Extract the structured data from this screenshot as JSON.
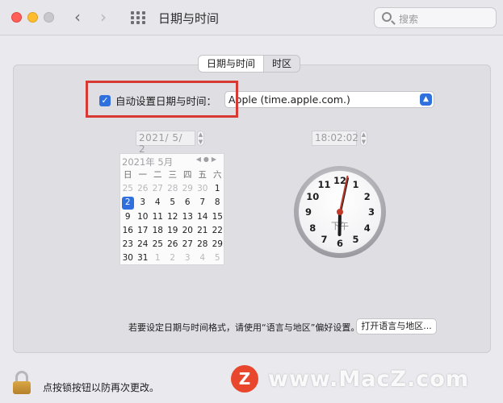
{
  "window": {
    "title": "日期与时间",
    "search_placeholder": "搜索"
  },
  "tabs": [
    {
      "label": "日期与时间",
      "active": true
    },
    {
      "label": "时区",
      "active": false
    }
  ],
  "auto_set": {
    "checked": true,
    "label": "自动设置日期与时间：",
    "server": "Apple (time.apple.com.)"
  },
  "date_field": "2021/ 5/ 2",
  "time_field": "18:02:02",
  "calendar": {
    "header": "2021年 5月",
    "weekdays": [
      "日",
      "一",
      "二",
      "三",
      "四",
      "五",
      "六"
    ],
    "selected_day": "2",
    "days": [
      [
        "25",
        "26",
        "27",
        "28",
        "29",
        "30",
        "1"
      ],
      [
        "2",
        "3",
        "4",
        "5",
        "6",
        "7",
        "8"
      ],
      [
        "9",
        "10",
        "11",
        "12",
        "13",
        "14",
        "15"
      ],
      [
        "16",
        "17",
        "18",
        "19",
        "20",
        "21",
        "22"
      ],
      [
        "23",
        "24",
        "25",
        "26",
        "27",
        "28",
        "29"
      ],
      [
        "30",
        "31",
        "1",
        "2",
        "3",
        "4",
        "5"
      ]
    ]
  },
  "clock": {
    "numbers": [
      "12",
      "1",
      "2",
      "3",
      "4",
      "5",
      "6",
      "7",
      "8",
      "9",
      "10",
      "11"
    ],
    "ampm": "下午",
    "hour": 18,
    "minute": 2,
    "second": 2
  },
  "hint_text": "若要设定日期与时间格式，请使用“语言与地区”偏好设置。",
  "open_button": "打开语言与地区...",
  "lock_text": "点按锁按钮以防再次更改。",
  "watermark": "www.MacZ.com",
  "watermark_logo": "Z",
  "colors": {
    "accent": "#2f6fde",
    "highlight_box": "#d63a32"
  }
}
